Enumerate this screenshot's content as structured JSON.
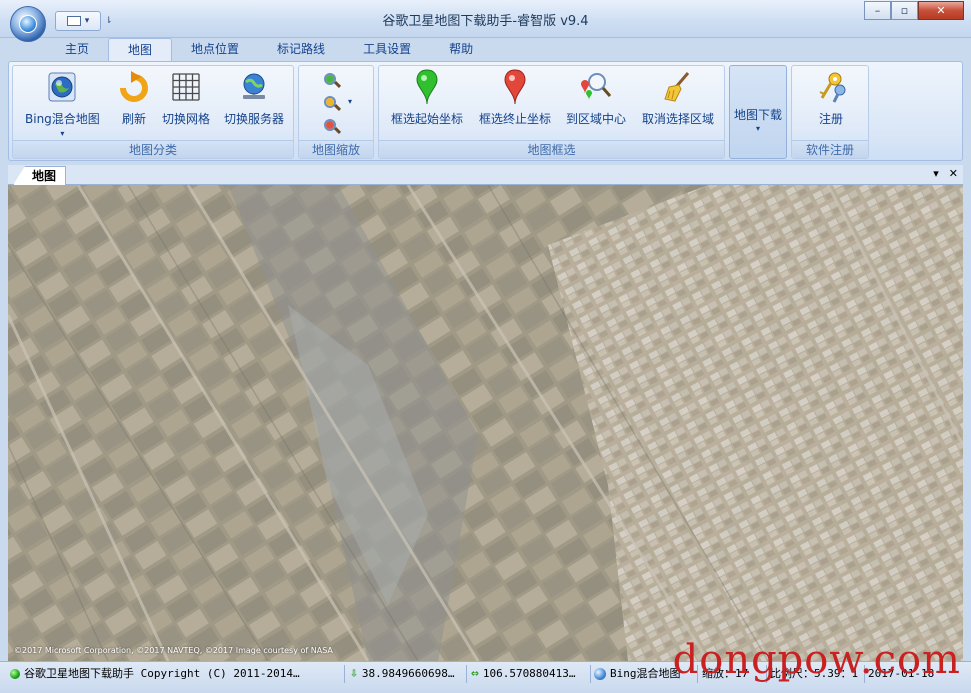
{
  "window": {
    "title": "谷歌卫星地图下载助手-睿智版 v9.4",
    "minimize": "–",
    "restore": "▫",
    "close": "✕"
  },
  "qat": {
    "more": "▾"
  },
  "tabs": [
    "主页",
    "地图",
    "地点位置",
    "标记路线",
    "工具设置",
    "帮助"
  ],
  "active_tab": "地图",
  "ribbon": {
    "map_category": {
      "label": "地图分类",
      "buttons": [
        {
          "label": "Bing混合地图",
          "icon": "globe-icon",
          "dropdown": "▾"
        },
        {
          "label": "刷新",
          "icon": "refresh-icon"
        },
        {
          "label": "切换网格",
          "icon": "grid-icon"
        },
        {
          "label": "切换服务器",
          "icon": "server-icon"
        }
      ]
    },
    "map_zoom": {
      "label": "地图缩放",
      "zoom_in": "zoom-in-icon",
      "zoom_out": "zoom-out-icon",
      "zoom_reset": "zoom-reset-icon",
      "dropdown": "▾"
    },
    "map_select": {
      "label": "地图框选",
      "buttons": [
        {
          "label": "框选起始坐标",
          "icon": "green-pin-icon",
          "color": "#2fbf2f"
        },
        {
          "label": "框选终止坐标",
          "icon": "red-pin-icon",
          "color": "#e2473b"
        },
        {
          "label": "到区域中心",
          "icon": "locate-icon"
        },
        {
          "label": "取消选择区域",
          "icon": "broom-icon"
        }
      ]
    },
    "map_download": {
      "label": "地图下载",
      "dropdown": "▾"
    },
    "register": {
      "label": "软件注册",
      "button": "注册",
      "icon": "keys-icon"
    }
  },
  "doc_tab": {
    "label": "地图",
    "menu": "▾",
    "close": "✕"
  },
  "map": {
    "credit": "©2017 Microsoft Corporation, ©2017 NAVTEQ, ©2017 Image courtesy of NASA"
  },
  "status": {
    "app": "谷歌卫星地图下载助手 Copyright (C) 2011-2014…",
    "lat": "38.9849660698…",
    "lng": "106.570880413…",
    "map_type": "Bing混合地图",
    "zoom": "缩放：17",
    "scale": "比例尺：5.39：1",
    "date": "2017-01-18"
  },
  "watermark": "dongpow.com",
  "colors": {
    "accent": "#15428b",
    "ribbon": "#dbe7f7",
    "watermark": "#c92121"
  }
}
